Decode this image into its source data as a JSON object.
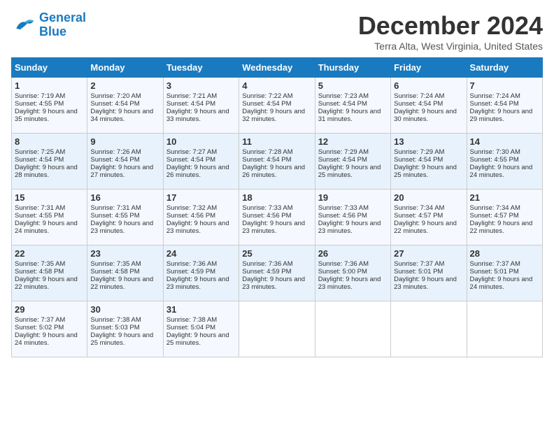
{
  "logo": {
    "line1": "General",
    "line2": "Blue"
  },
  "title": "December 2024",
  "subtitle": "Terra Alta, West Virginia, United States",
  "days_header": [
    "Sunday",
    "Monday",
    "Tuesday",
    "Wednesday",
    "Thursday",
    "Friday",
    "Saturday"
  ],
  "weeks": [
    [
      {
        "day": "1",
        "sunrise": "Sunrise: 7:19 AM",
        "sunset": "Sunset: 4:55 PM",
        "daylight": "Daylight: 9 hours and 35 minutes."
      },
      {
        "day": "2",
        "sunrise": "Sunrise: 7:20 AM",
        "sunset": "Sunset: 4:54 PM",
        "daylight": "Daylight: 9 hours and 34 minutes."
      },
      {
        "day": "3",
        "sunrise": "Sunrise: 7:21 AM",
        "sunset": "Sunset: 4:54 PM",
        "daylight": "Daylight: 9 hours and 33 minutes."
      },
      {
        "day": "4",
        "sunrise": "Sunrise: 7:22 AM",
        "sunset": "Sunset: 4:54 PM",
        "daylight": "Daylight: 9 hours and 32 minutes."
      },
      {
        "day": "5",
        "sunrise": "Sunrise: 7:23 AM",
        "sunset": "Sunset: 4:54 PM",
        "daylight": "Daylight: 9 hours and 31 minutes."
      },
      {
        "day": "6",
        "sunrise": "Sunrise: 7:24 AM",
        "sunset": "Sunset: 4:54 PM",
        "daylight": "Daylight: 9 hours and 30 minutes."
      },
      {
        "day": "7",
        "sunrise": "Sunrise: 7:24 AM",
        "sunset": "Sunset: 4:54 PM",
        "daylight": "Daylight: 9 hours and 29 minutes."
      }
    ],
    [
      {
        "day": "8",
        "sunrise": "Sunrise: 7:25 AM",
        "sunset": "Sunset: 4:54 PM",
        "daylight": "Daylight: 9 hours and 28 minutes."
      },
      {
        "day": "9",
        "sunrise": "Sunrise: 7:26 AM",
        "sunset": "Sunset: 4:54 PM",
        "daylight": "Daylight: 9 hours and 27 minutes."
      },
      {
        "day": "10",
        "sunrise": "Sunrise: 7:27 AM",
        "sunset": "Sunset: 4:54 PM",
        "daylight": "Daylight: 9 hours and 26 minutes."
      },
      {
        "day": "11",
        "sunrise": "Sunrise: 7:28 AM",
        "sunset": "Sunset: 4:54 PM",
        "daylight": "Daylight: 9 hours and 26 minutes."
      },
      {
        "day": "12",
        "sunrise": "Sunrise: 7:29 AM",
        "sunset": "Sunset: 4:54 PM",
        "daylight": "Daylight: 9 hours and 25 minutes."
      },
      {
        "day": "13",
        "sunrise": "Sunrise: 7:29 AM",
        "sunset": "Sunset: 4:54 PM",
        "daylight": "Daylight: 9 hours and 25 minutes."
      },
      {
        "day": "14",
        "sunrise": "Sunrise: 7:30 AM",
        "sunset": "Sunset: 4:55 PM",
        "daylight": "Daylight: 9 hours and 24 minutes."
      }
    ],
    [
      {
        "day": "15",
        "sunrise": "Sunrise: 7:31 AM",
        "sunset": "Sunset: 4:55 PM",
        "daylight": "Daylight: 9 hours and 24 minutes."
      },
      {
        "day": "16",
        "sunrise": "Sunrise: 7:31 AM",
        "sunset": "Sunset: 4:55 PM",
        "daylight": "Daylight: 9 hours and 23 minutes."
      },
      {
        "day": "17",
        "sunrise": "Sunrise: 7:32 AM",
        "sunset": "Sunset: 4:56 PM",
        "daylight": "Daylight: 9 hours and 23 minutes."
      },
      {
        "day": "18",
        "sunrise": "Sunrise: 7:33 AM",
        "sunset": "Sunset: 4:56 PM",
        "daylight": "Daylight: 9 hours and 23 minutes."
      },
      {
        "day": "19",
        "sunrise": "Sunrise: 7:33 AM",
        "sunset": "Sunset: 4:56 PM",
        "daylight": "Daylight: 9 hours and 23 minutes."
      },
      {
        "day": "20",
        "sunrise": "Sunrise: 7:34 AM",
        "sunset": "Sunset: 4:57 PM",
        "daylight": "Daylight: 9 hours and 22 minutes."
      },
      {
        "day": "21",
        "sunrise": "Sunrise: 7:34 AM",
        "sunset": "Sunset: 4:57 PM",
        "daylight": "Daylight: 9 hours and 22 minutes."
      }
    ],
    [
      {
        "day": "22",
        "sunrise": "Sunrise: 7:35 AM",
        "sunset": "Sunset: 4:58 PM",
        "daylight": "Daylight: 9 hours and 22 minutes."
      },
      {
        "day": "23",
        "sunrise": "Sunrise: 7:35 AM",
        "sunset": "Sunset: 4:58 PM",
        "daylight": "Daylight: 9 hours and 22 minutes."
      },
      {
        "day": "24",
        "sunrise": "Sunrise: 7:36 AM",
        "sunset": "Sunset: 4:59 PM",
        "daylight": "Daylight: 9 hours and 23 minutes."
      },
      {
        "day": "25",
        "sunrise": "Sunrise: 7:36 AM",
        "sunset": "Sunset: 4:59 PM",
        "daylight": "Daylight: 9 hours and 23 minutes."
      },
      {
        "day": "26",
        "sunrise": "Sunrise: 7:36 AM",
        "sunset": "Sunset: 5:00 PM",
        "daylight": "Daylight: 9 hours and 23 minutes."
      },
      {
        "day": "27",
        "sunrise": "Sunrise: 7:37 AM",
        "sunset": "Sunset: 5:01 PM",
        "daylight": "Daylight: 9 hours and 23 minutes."
      },
      {
        "day": "28",
        "sunrise": "Sunrise: 7:37 AM",
        "sunset": "Sunset: 5:01 PM",
        "daylight": "Daylight: 9 hours and 24 minutes."
      }
    ],
    [
      {
        "day": "29",
        "sunrise": "Sunrise: 7:37 AM",
        "sunset": "Sunset: 5:02 PM",
        "daylight": "Daylight: 9 hours and 24 minutes."
      },
      {
        "day": "30",
        "sunrise": "Sunrise: 7:38 AM",
        "sunset": "Sunset: 5:03 PM",
        "daylight": "Daylight: 9 hours and 25 minutes."
      },
      {
        "day": "31",
        "sunrise": "Sunrise: 7:38 AM",
        "sunset": "Sunset: 5:04 PM",
        "daylight": "Daylight: 9 hours and 25 minutes."
      },
      null,
      null,
      null,
      null
    ]
  ]
}
